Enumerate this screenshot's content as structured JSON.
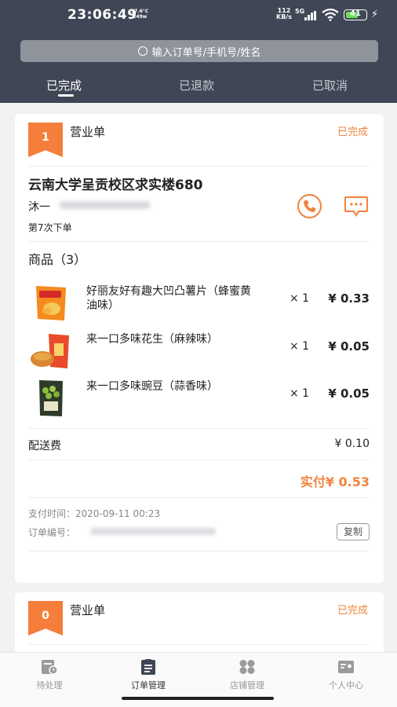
{
  "status_bar": {
    "time": "23:06:49",
    "temp_line1": "37.6°C",
    "temp_line2": "1.49w",
    "net_speed": "112",
    "net_unit": "KB/s",
    "network": "5G",
    "battery": "41"
  },
  "search": {
    "placeholder": "输入订单号/手机号/姓名",
    "icon": "search-icon"
  },
  "tabs": [
    {
      "label": "已完成",
      "active": true
    },
    {
      "label": "已退款",
      "active": false
    },
    {
      "label": "已取消",
      "active": false
    }
  ],
  "orders": [
    {
      "index": "1",
      "type": "营业单",
      "status": "已完成",
      "address": "云南大学呈贡校区求实楼680",
      "customer": "沐一",
      "order_count": "第7次下单",
      "goods_title": "商品（3）",
      "items": [
        {
          "name": "好丽友好有趣大凹凸薯片（蜂蜜黄油味）",
          "qty": "× 1",
          "price": "¥ 0.33"
        },
        {
          "name": "来一口多味花生（麻辣味）",
          "qty": "× 1",
          "price": "¥ 0.05"
        },
        {
          "name": "来一口多味豌豆（蒜香味）",
          "qty": "× 1",
          "price": "¥ 0.05"
        }
      ],
      "delivery_fee_label": "配送费",
      "delivery_fee": "¥ 0.10",
      "total": "实付¥ 0.53",
      "pay_time": "支付时间：2020-09-11 00:23",
      "order_no_label": "订单编号：",
      "copy_label": "复制"
    },
    {
      "index": "0",
      "type": "营业单",
      "status": "已完成"
    }
  ],
  "bottom_nav": [
    {
      "label": "待处理",
      "icon": "pending-icon",
      "active": false
    },
    {
      "label": "订单管理",
      "icon": "clipboard-icon",
      "active": true
    },
    {
      "label": "店铺管理",
      "icon": "store-grid-icon",
      "active": false
    },
    {
      "label": "个人中心",
      "icon": "profile-card-icon",
      "active": false
    }
  ],
  "colors": {
    "header": "#3f4655",
    "accent": "#f0843d",
    "flag": "#f47e3a"
  }
}
